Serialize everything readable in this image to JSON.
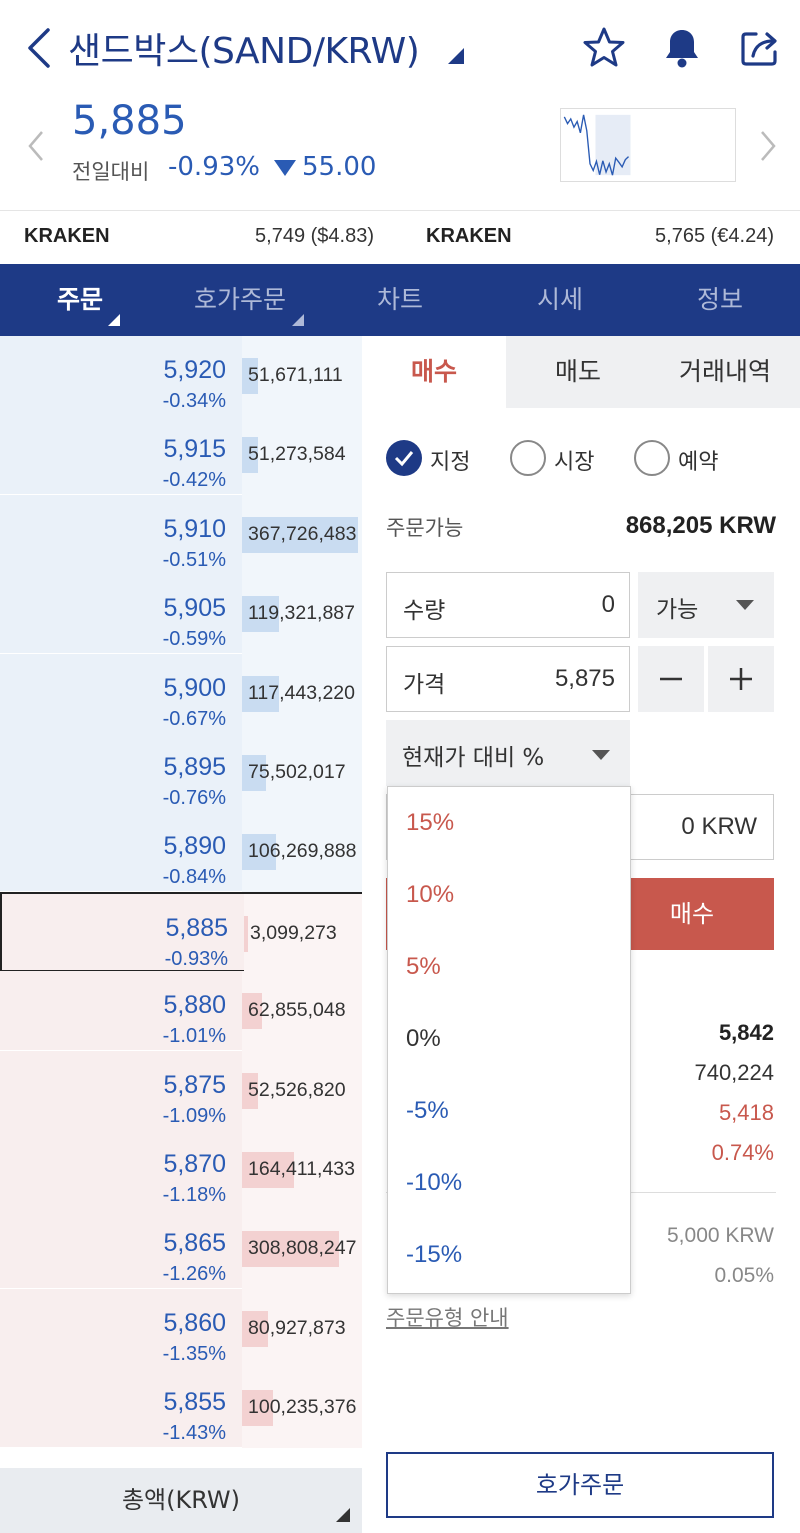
{
  "header": {
    "title": "샌드박스(SAND/KRW)",
    "price": "5,885",
    "change_label": "전일대비",
    "change_pct": "-0.93%",
    "change_amount": "55.00",
    "sparkline": [
      5988,
      5975,
      5984,
      5968,
      5979,
      5957,
      5992,
      5961,
      5897,
      5884,
      5902,
      5876,
      5903,
      5881,
      5897,
      5875,
      5908,
      5900,
      5891,
      5905,
      5911
    ]
  },
  "exchanges": [
    {
      "name": "KRAKEN",
      "value": "5,749 ($4.83)"
    },
    {
      "name": "KRAKEN",
      "value": "5,765 (€4.24)"
    }
  ],
  "nav": {
    "tabs": [
      "주문",
      "호가주문",
      "차트",
      "시세",
      "정보"
    ]
  },
  "orderbook": {
    "rows": [
      {
        "price": "5,920",
        "pct": "-0.34%",
        "volume": "51,671,111",
        "side": "sell",
        "bar": 0.14
      },
      {
        "price": "5,915",
        "pct": "-0.42%",
        "volume": "51,273,584",
        "side": "sell",
        "bar": 0.14
      },
      {
        "price": "5,910",
        "pct": "-0.51%",
        "volume": "367,726,483",
        "side": "sell",
        "bar": 1.0
      },
      {
        "price": "5,905",
        "pct": "-0.59%",
        "volume": "119,321,887",
        "side": "sell",
        "bar": 0.32
      },
      {
        "price": "5,900",
        "pct": "-0.67%",
        "volume": "117,443,220",
        "side": "sell",
        "bar": 0.32
      },
      {
        "price": "5,895",
        "pct": "-0.76%",
        "volume": "75,502,017",
        "side": "sell",
        "bar": 0.21
      },
      {
        "price": "5,890",
        "pct": "-0.84%",
        "volume": "106,269,888",
        "side": "sell",
        "bar": 0.29
      },
      {
        "price": "5,885",
        "pct": "-0.93%",
        "volume": "3,099,273",
        "side": "buy",
        "bar": 0.01
      },
      {
        "price": "5,880",
        "pct": "-1.01%",
        "volume": "62,855,048",
        "side": "buy",
        "bar": 0.17
      },
      {
        "price": "5,875",
        "pct": "-1.09%",
        "volume": "52,526,820",
        "side": "buy",
        "bar": 0.14
      },
      {
        "price": "5,870",
        "pct": "-1.18%",
        "volume": "164,411,433",
        "side": "buy",
        "bar": 0.45
      },
      {
        "price": "5,865",
        "pct": "-1.26%",
        "volume": "308,808,247",
        "side": "buy",
        "bar": 0.84
      },
      {
        "price": "5,860",
        "pct": "-1.35%",
        "volume": "80,927,873",
        "side": "buy",
        "bar": 0.22
      },
      {
        "price": "5,855",
        "pct": "-1.43%",
        "volume": "100,235,376",
        "side": "buy",
        "bar": 0.27
      }
    ],
    "footer_label": "총액(KRW)"
  },
  "panel": {
    "tabs": [
      "매수",
      "매도",
      "거래내역"
    ],
    "order_types": [
      "지정",
      "시장",
      "예약"
    ],
    "available_label": "주문가능",
    "available_value": "868,205 KRW",
    "qty_label": "수량",
    "qty_value": "0",
    "qty_dropdown": "가능",
    "price_label": "가격",
    "price_value": "5,875",
    "pct_dropdown": "현재가 대비 %",
    "total_value": "0 KRW",
    "buy_button": "매수",
    "stats": [
      "5,842",
      "740,224",
      "5,418",
      "0.74%"
    ],
    "min_order": "5,000 KRW",
    "fee": "0.05%",
    "order_type_link": "주문유형 안내",
    "hoga_button": "호가주문"
  },
  "pct_menu": {
    "options": [
      "15%",
      "10%",
      "5%",
      "0%",
      "-5%",
      "-10%",
      "-15%"
    ]
  },
  "colors": {
    "brand": "#1e3a86",
    "down": "#2a5bb4",
    "up": "#c8584d"
  }
}
